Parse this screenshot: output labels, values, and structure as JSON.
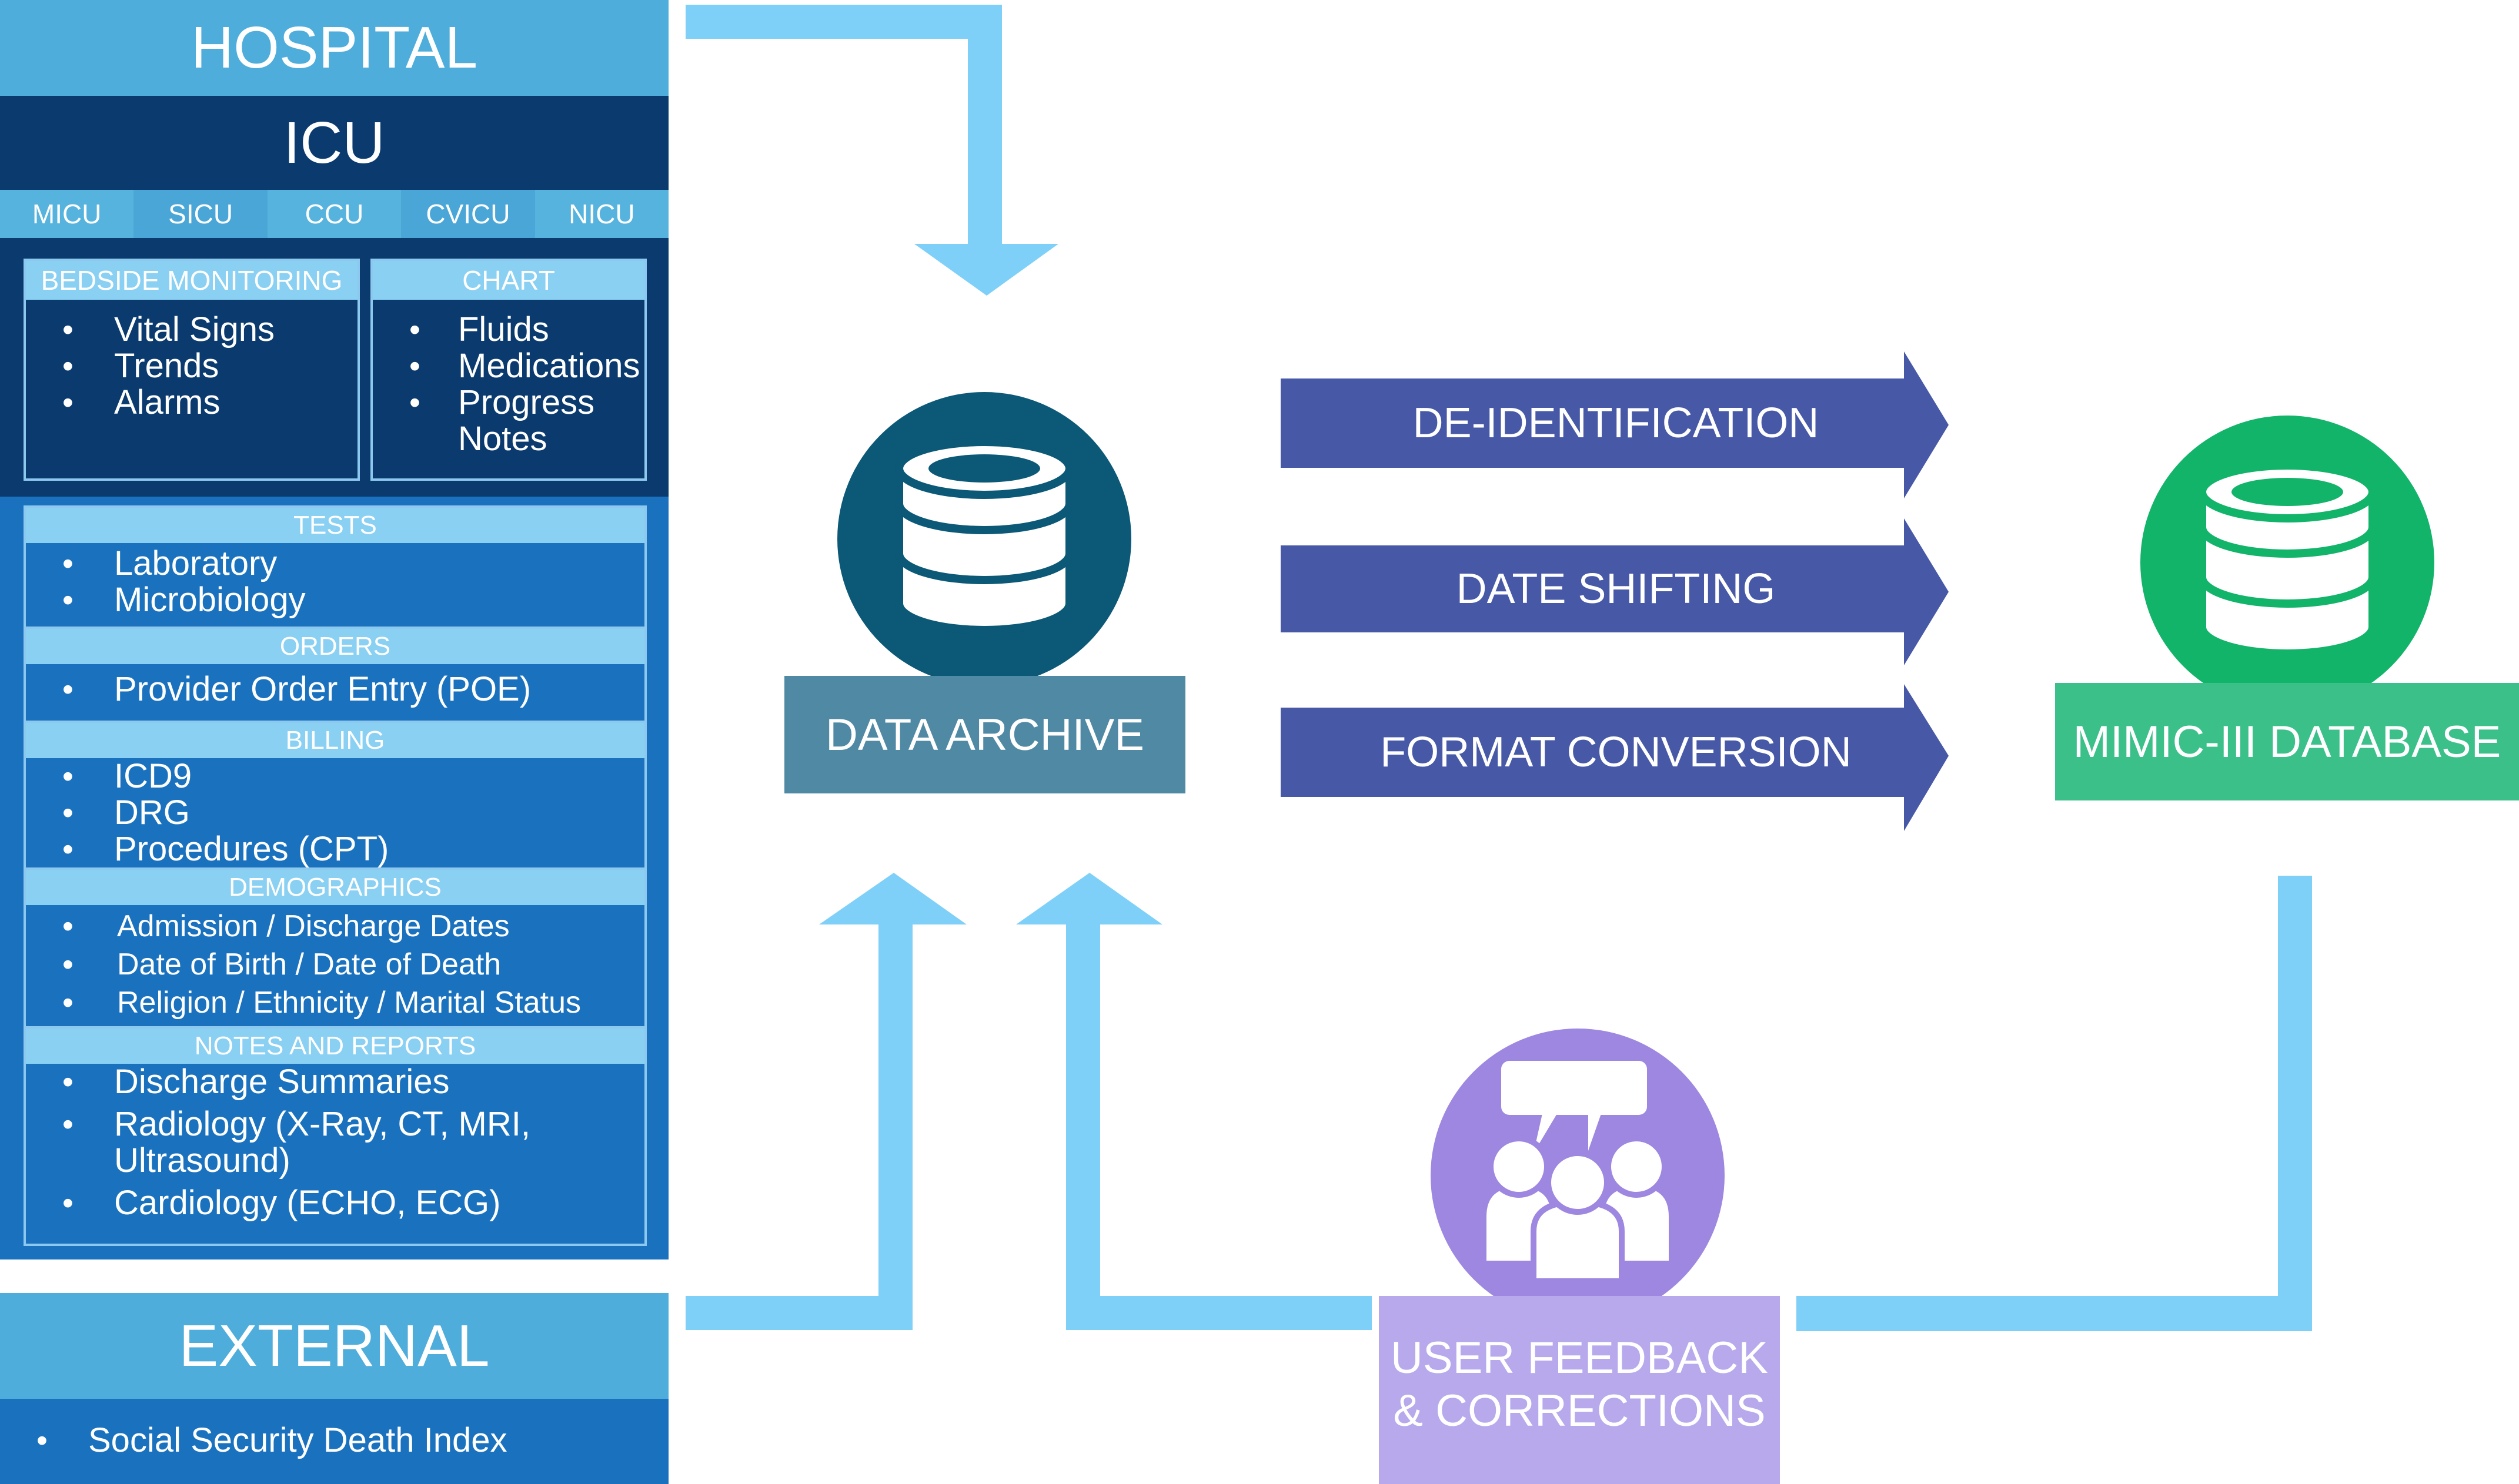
{
  "hospital": {
    "title": "HOSPITAL",
    "icu_title": "ICU",
    "units": [
      "MICU",
      "SICU",
      "CCU",
      "CVICU",
      "NICU"
    ],
    "bedside": {
      "heading": "BEDSIDE MONITORING",
      "items": [
        "Vital Signs",
        "Trends",
        "Alarms"
      ]
    },
    "chart": {
      "heading": "CHART",
      "items": [
        "Fluids",
        "Medications",
        "Progress Notes"
      ]
    },
    "sections": [
      {
        "heading": "TESTS",
        "items": [
          "Laboratory",
          "Microbiology"
        ]
      },
      {
        "heading": "ORDERS",
        "items": [
          "Provider Order Entry (POE)"
        ]
      },
      {
        "heading": "BILLING",
        "items": [
          "ICD9",
          "DRG",
          "Procedures (CPT)"
        ]
      },
      {
        "heading": "DEMOGRAPHICS",
        "items": [
          "Admission / Discharge Dates",
          "Date of Birth / Date of Death",
          "Religion / Ethnicity / Marital Status"
        ]
      },
      {
        "heading": "NOTES AND REPORTS",
        "items": [
          "Discharge Summaries",
          "Radiology (X-Ray, CT, MRI, Ultrasound)",
          "Cardiology (ECHO, ECG)"
        ]
      }
    ]
  },
  "external": {
    "title": "EXTERNAL",
    "items": [
      "Social Security Death Index"
    ]
  },
  "archive": {
    "label": "DATA ARCHIVE",
    "icon": "database-icon"
  },
  "processes": [
    "DE-IDENTIFICATION",
    "DATE SHIFTING",
    "FORMAT CONVERSION"
  ],
  "mimic": {
    "label": "MIMIC-III DATABASE",
    "icon": "database-icon"
  },
  "feedback": {
    "line1": "USER FEEDBACK",
    "line2": "& CORRECTIONS",
    "icon": "people-speech-icon"
  },
  "colors": {
    "hospital_header": "#4eaddb",
    "icu_dark": "#0a3a6e",
    "lower_panel": "#1a72bf",
    "light_blue": "#8ad0f3",
    "flow_arrow": "#7fd0f8",
    "archive_circle": "#0b5877",
    "archive_label": "#5089a4",
    "process_arrow": "#4658a6",
    "mimic_circle": "#12b46a",
    "mimic_label": "#3cc08a",
    "feedback_circle": "#9d87e0",
    "feedback_label": "#b7a9ec"
  }
}
